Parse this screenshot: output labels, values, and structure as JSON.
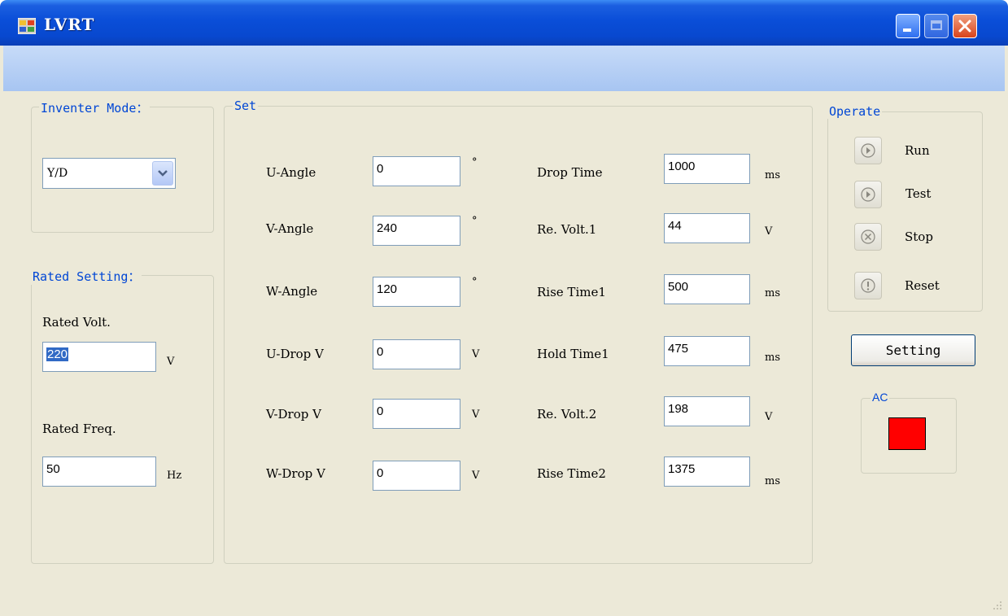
{
  "window": {
    "title": "LVRT",
    "colors": {
      "title_bar": "#0a4ed8",
      "face": "#ece9d8",
      "group_title": "#0046d5",
      "ac_indicator": "#ff0000"
    }
  },
  "inverter_mode": {
    "legend": "Inventer Mode：",
    "selected": "Y/D"
  },
  "rated_setting": {
    "legend": "Rated Setting：",
    "volt_label": "Rated Volt.",
    "volt_value": "220",
    "volt_unit": "V",
    "freq_label": "Rated Freq.",
    "freq_value": "50",
    "freq_unit": "Hz"
  },
  "set": {
    "legend": "Set",
    "left_rows": [
      {
        "label": "U-Angle",
        "value": "0",
        "unit": "°"
      },
      {
        "label": "V-Angle",
        "value": "240",
        "unit": "°"
      },
      {
        "label": "W-Angle",
        "value": "120",
        "unit": "°"
      },
      {
        "label": "U-Drop V",
        "value": "0",
        "unit": "V"
      },
      {
        "label": "V-Drop V",
        "value": "0",
        "unit": "V"
      },
      {
        "label": "W-Drop V",
        "value": "0",
        "unit": "V"
      }
    ],
    "right_rows": [
      {
        "label": "Drop Time",
        "value": "1000",
        "unit": "ms"
      },
      {
        "label": "Re. Volt.1",
        "value": "44",
        "unit": "V"
      },
      {
        "label": "Rise Time1",
        "value": "500",
        "unit": "ms"
      },
      {
        "label": "Hold Time1",
        "value": "475",
        "unit": "ms"
      },
      {
        "label": "Re. Volt.2",
        "value": "198",
        "unit": "V"
      },
      {
        "label": "Rise Time2",
        "value": "1375",
        "unit": "ms"
      }
    ]
  },
  "operate": {
    "legend": "Operate",
    "buttons": [
      {
        "label": "Run",
        "icon": "play-icon"
      },
      {
        "label": "Test",
        "icon": "play-icon"
      },
      {
        "label": "Stop",
        "icon": "stop-x-icon"
      },
      {
        "label": "Reset",
        "icon": "exclamation-icon"
      }
    ]
  },
  "setting_button": "Setting",
  "ac": {
    "legend": "AC"
  }
}
